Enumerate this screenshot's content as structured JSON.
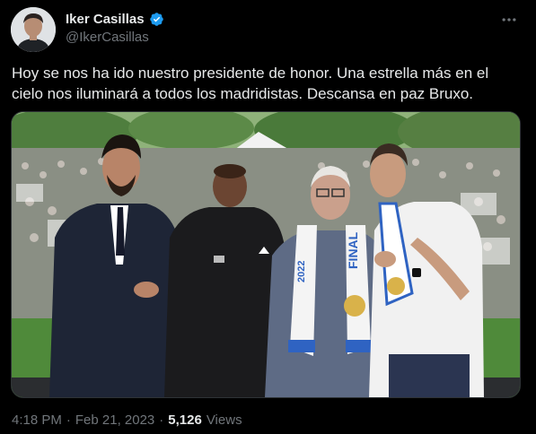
{
  "author": {
    "display_name": "Iker Casillas",
    "handle": "@IkerCasillas",
    "verified": true
  },
  "tweet": {
    "text": "Hoy se nos ha ido nuestro presidente de honor. Una estrella más en el cielo nos iluminará a todos los madridistas. Descansa en paz Bruxo."
  },
  "media": {
    "scarf_text_left": "2022",
    "scarf_text_right": "FINAL"
  },
  "meta": {
    "time": "4:18 PM",
    "separator": "·",
    "date": "Feb 21, 2023",
    "views_count": "5,126",
    "views_label": "Views"
  },
  "colors": {
    "background": "#000000",
    "text_primary": "#e7e9ea",
    "text_secondary": "#71767b",
    "verified_blue": "#1d9bf0",
    "border": "#2f3336"
  },
  "icons": {
    "verified": "verified-badge-icon",
    "more": "more-options-icon"
  }
}
